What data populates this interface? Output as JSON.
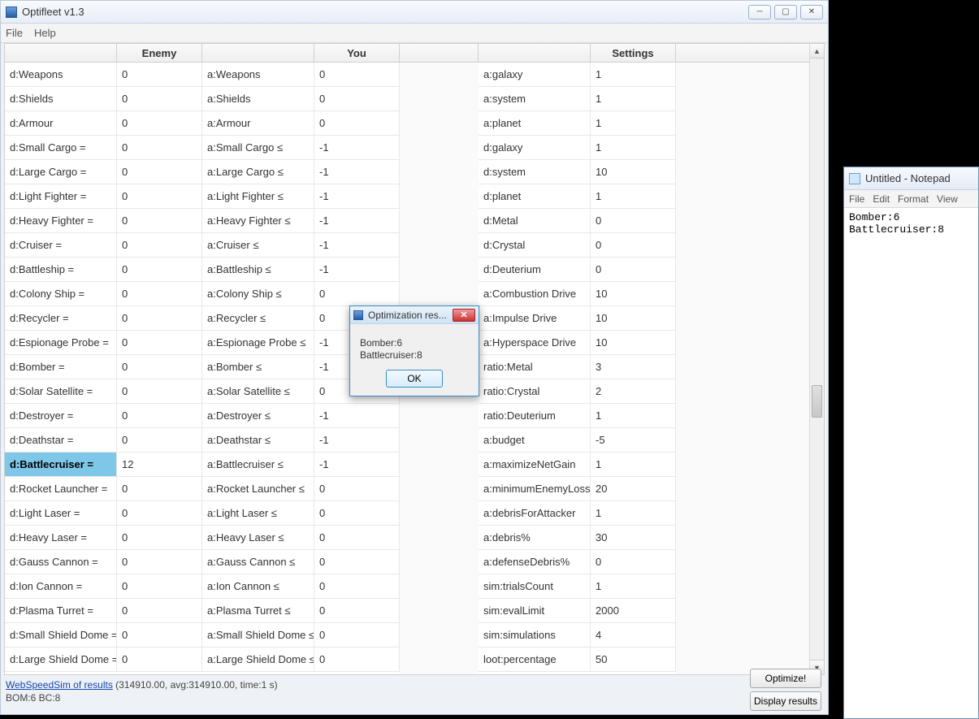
{
  "main": {
    "title": "Optifleet v1.3",
    "menu": {
      "file": "File",
      "help": "Help"
    },
    "headers": {
      "enemy": "Enemy",
      "you": "You",
      "settings": "Settings"
    },
    "enemy": [
      {
        "k": "d:Weapons",
        "v": "0"
      },
      {
        "k": "d:Shields",
        "v": "0"
      },
      {
        "k": "d:Armour",
        "v": "0"
      },
      {
        "k": "d:Small Cargo =",
        "v": "0"
      },
      {
        "k": "d:Large Cargo =",
        "v": "0"
      },
      {
        "k": "d:Light Fighter =",
        "v": "0"
      },
      {
        "k": "d:Heavy Fighter =",
        "v": "0"
      },
      {
        "k": "d:Cruiser =",
        "v": "0"
      },
      {
        "k": "d:Battleship =",
        "v": "0"
      },
      {
        "k": "d:Colony Ship =",
        "v": "0"
      },
      {
        "k": "d:Recycler =",
        "v": "0"
      },
      {
        "k": "d:Espionage Probe =",
        "v": "0"
      },
      {
        "k": "d:Bomber =",
        "v": "0"
      },
      {
        "k": "d:Solar Satellite =",
        "v": "0"
      },
      {
        "k": "d:Destroyer =",
        "v": "0"
      },
      {
        "k": "d:Deathstar =",
        "v": "0"
      },
      {
        "k": "d:Battlecruiser =",
        "v": "12",
        "selected": true
      },
      {
        "k": "d:Rocket Launcher =",
        "v": "0"
      },
      {
        "k": "d:Light Laser =",
        "v": "0"
      },
      {
        "k": "d:Heavy Laser =",
        "v": "0"
      },
      {
        "k": "d:Gauss Cannon =",
        "v": "0"
      },
      {
        "k": "d:Ion Cannon =",
        "v": "0"
      },
      {
        "k": "d:Plasma Turret =",
        "v": "0"
      },
      {
        "k": "d:Small Shield Dome =",
        "v": "0"
      },
      {
        "k": "d:Large Shield Dome =",
        "v": "0"
      }
    ],
    "you": [
      {
        "k": "a:Weapons",
        "v": "0"
      },
      {
        "k": "a:Shields",
        "v": "0"
      },
      {
        "k": "a:Armour",
        "v": "0"
      },
      {
        "k": "a:Small Cargo ≤",
        "v": "-1"
      },
      {
        "k": "a:Large Cargo ≤",
        "v": "-1"
      },
      {
        "k": "a:Light Fighter ≤",
        "v": "-1"
      },
      {
        "k": "a:Heavy Fighter ≤",
        "v": "-1"
      },
      {
        "k": "a:Cruiser ≤",
        "v": "-1"
      },
      {
        "k": "a:Battleship ≤",
        "v": "-1"
      },
      {
        "k": "a:Colony Ship ≤",
        "v": "0"
      },
      {
        "k": "a:Recycler ≤",
        "v": "0"
      },
      {
        "k": "a:Espionage Probe ≤",
        "v": "-1"
      },
      {
        "k": "a:Bomber ≤",
        "v": "-1"
      },
      {
        "k": "a:Solar Satellite ≤",
        "v": "0"
      },
      {
        "k": "a:Destroyer ≤",
        "v": "-1"
      },
      {
        "k": "a:Deathstar ≤",
        "v": "-1"
      },
      {
        "k": "a:Battlecruiser ≤",
        "v": "-1"
      },
      {
        "k": "a:Rocket Launcher ≤",
        "v": "0"
      },
      {
        "k": "a:Light Laser ≤",
        "v": "0"
      },
      {
        "k": "a:Heavy Laser ≤",
        "v": "0"
      },
      {
        "k": "a:Gauss Cannon ≤",
        "v": "0"
      },
      {
        "k": "a:Ion Cannon ≤",
        "v": "0"
      },
      {
        "k": "a:Plasma Turret ≤",
        "v": "0"
      },
      {
        "k": "a:Small Shield Dome ≤",
        "v": "0"
      },
      {
        "k": "a:Large Shield Dome ≤",
        "v": "0"
      }
    ],
    "settings": [
      {
        "k": "a:galaxy",
        "v": "1"
      },
      {
        "k": "a:system",
        "v": "1"
      },
      {
        "k": "a:planet",
        "v": "1"
      },
      {
        "k": "d:galaxy",
        "v": "1"
      },
      {
        "k": "d:system",
        "v": "10"
      },
      {
        "k": "d:planet",
        "v": "1"
      },
      {
        "k": "d:Metal",
        "v": "0"
      },
      {
        "k": "d:Crystal",
        "v": "0"
      },
      {
        "k": "d:Deuterium",
        "v": "0"
      },
      {
        "k": "a:Combustion Drive",
        "v": "10"
      },
      {
        "k": "a:Impulse Drive",
        "v": "10"
      },
      {
        "k": "a:Hyperspace Drive",
        "v": "10"
      },
      {
        "k": "ratio:Metal",
        "v": "3"
      },
      {
        "k": "ratio:Crystal",
        "v": "2"
      },
      {
        "k": "ratio:Deuterium",
        "v": "1"
      },
      {
        "k": "a:budget",
        "v": "-5"
      },
      {
        "k": "a:maximizeNetGain",
        "v": "1"
      },
      {
        "k": "a:minimumEnemyLoss%",
        "v": "20"
      },
      {
        "k": "a:debrisForAttacker",
        "v": "1"
      },
      {
        "k": "a:debris%",
        "v": "30"
      },
      {
        "k": "a:defenseDebris%",
        "v": "0"
      },
      {
        "k": "sim:trialsCount",
        "v": "1"
      },
      {
        "k": "sim:evalLimit",
        "v": "2000"
      },
      {
        "k": "sim:simulations",
        "v": "4"
      },
      {
        "k": "loot:percentage",
        "v": "50"
      }
    ],
    "status": {
      "link": "WebSpeedSim of results",
      "linkrest": " (314910.00, avg:314910.00, time:1 s)",
      "line2": "BOM:6 BC:8"
    },
    "buttons": {
      "optimize": "Optimize!",
      "display": "Display results"
    }
  },
  "dialog": {
    "title": "Optimization res...",
    "line1": "Bomber:6",
    "line2": "Battlecruiser:8",
    "ok": "OK"
  },
  "notepad": {
    "title": "Untitled - Notepad",
    "menu": {
      "file": "File",
      "edit": "Edit",
      "format": "Format",
      "view": "View"
    },
    "content": "Bomber:6\nBattlecruiser:8"
  }
}
